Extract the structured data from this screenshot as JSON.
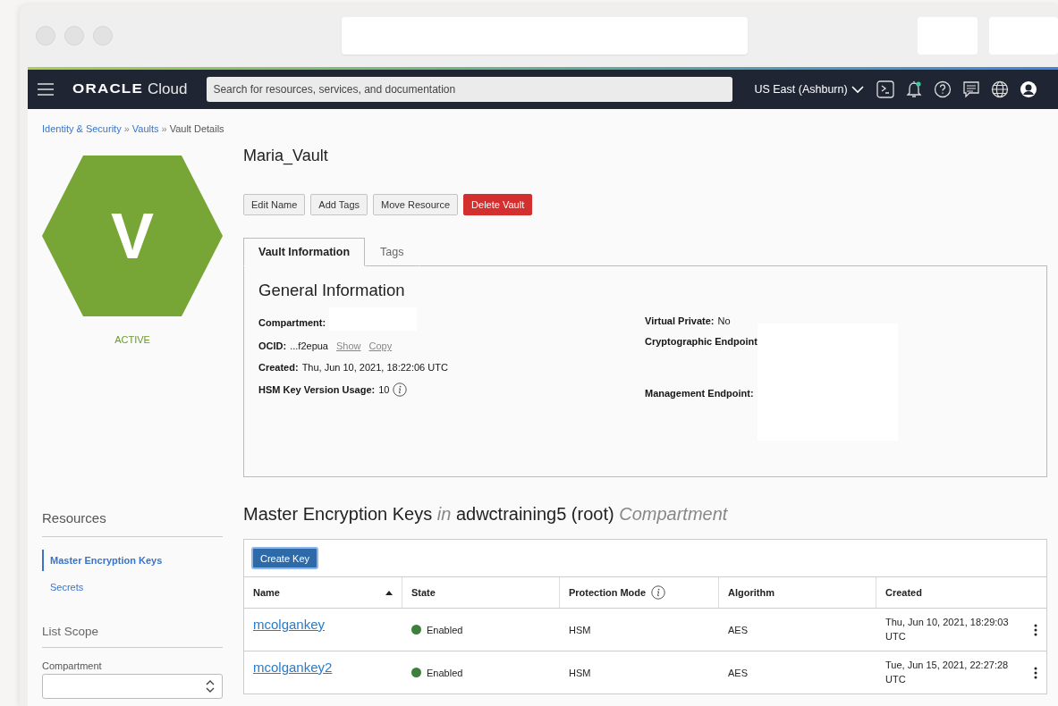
{
  "navbar": {
    "logo": "ORACLE",
    "product": "Cloud",
    "search": {
      "placeholder": "Search for resources, services, and documentation"
    },
    "region": "US East (Ashburn)",
    "notifications": true
  },
  "breadcrumb": [
    {
      "label": "Identity & Security",
      "kind": "link"
    },
    {
      "label": "Vaults",
      "kind": "link"
    },
    {
      "label": "Vault Details",
      "kind": "current"
    }
  ],
  "breadcrumb_separator": "»",
  "resource": {
    "letter": "V",
    "status": "ACTIVE",
    "name": "Maria_Vault"
  },
  "actions": [
    {
      "label": "Edit Name",
      "kind": "default"
    },
    {
      "label": "Add Tags",
      "kind": "default"
    },
    {
      "label": "Move Resource",
      "kind": "default"
    },
    {
      "label": "Delete Vault",
      "kind": "danger"
    }
  ],
  "tabs": [
    {
      "label": "Vault Information",
      "selected": true
    },
    {
      "label": "Tags",
      "selected": false
    }
  ],
  "general_information": {
    "title": "General Information",
    "left": [
      {
        "label": "Compartment:",
        "kind": "redacted"
      },
      {
        "label": "OCID:",
        "kind": "ocid",
        "value": "...f2epua",
        "links": [
          "Show",
          "Copy"
        ]
      },
      {
        "label": "Created:",
        "kind": "text",
        "value": "Thu, Jun 10, 2021, 18:22:06 UTC"
      },
      {
        "label": "HSM Key Version Usage:",
        "kind": "info",
        "value": "10"
      }
    ],
    "right": [
      {
        "label": "Virtual Private:",
        "kind": "text",
        "value": "No"
      },
      {
        "label": "Cryptographic Endpoint",
        "kind": "redacted"
      },
      {
        "label": "Management Endpoint:",
        "kind": "redacted"
      }
    ]
  },
  "sidebar": {
    "title": "Resources",
    "items": [
      {
        "label": "Master Encryption Keys",
        "selected": true
      },
      {
        "label": "Secrets",
        "selected": false
      }
    ],
    "scope_title": "List Scope",
    "compartment_label": "Compartment"
  },
  "keys": {
    "title": "Master Encryption Keys *in* adwctraining5 (root) *Compartment*",
    "create_button": "Create Key",
    "columns": [
      {
        "label": "Name",
        "sorted_ascending": true
      },
      {
        "label": "State"
      },
      {
        "label": "Protection Mode",
        "info": true
      },
      {
        "label": "Algorithm"
      },
      {
        "label": "Created"
      }
    ],
    "rows": [
      {
        "name": "mcolgankey",
        "state": {
          "label": "Enabled",
          "color": "#3f7e3b"
        },
        "protection_mode": "HSM",
        "algorithm": "AES",
        "created": "Thu, Jun 10, 2021, 18:29:03 UTC"
      },
      {
        "name": "mcolgankey2",
        "state": {
          "label": "Enabled",
          "color": "#3f7e3b"
        },
        "protection_mode": "HSM",
        "algorithm": "AES",
        "created": "Tue, Jun 15, 2021, 22:27:28 UTC"
      }
    ]
  }
}
